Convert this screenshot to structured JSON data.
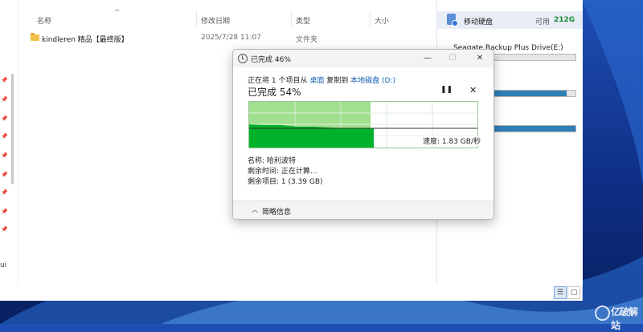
{
  "explorer": {
    "columns": {
      "name": "名称",
      "modified": "修改日期",
      "type": "类型",
      "size": "大小"
    },
    "rows": [
      {
        "name": "kindleren 精品【最终版】",
        "modified": "2025/7/28 11:07",
        "type": "文件夹",
        "size": ""
      }
    ],
    "nav_clip_text": "ui"
  },
  "details": {
    "drive_name": "移动硬盘",
    "available_label": "可用",
    "available_value": "212G",
    "drive_full_name": "Seagate Backup Plus Drive(E:)",
    "bars_fill": [
      0.1,
      0.93,
      1.0
    ]
  },
  "dialog": {
    "title": "已完成 46%",
    "line_prefix": "正在将 1 个项目从",
    "source": "桌面",
    "copy_to": "复制到",
    "destination": "本地磁盘 (D:)",
    "percent_text": "已完成 54%",
    "pause_icon": "pause-icon",
    "speed_text": "速度: 1.83 GB/秒",
    "name_row": "名称: 哈利波特",
    "time_row": "剩余时间: 正在计算...",
    "items_row": "剩余项目: 1 (3.39 GB)",
    "brief_label": "简略信息",
    "progress": 0.54
  },
  "logo": {
    "text": "亿破解站"
  },
  "colors": {
    "graph_fill": "#00b22a",
    "graph_light": "#9fe08f",
    "link": "#1a5fb4"
  }
}
